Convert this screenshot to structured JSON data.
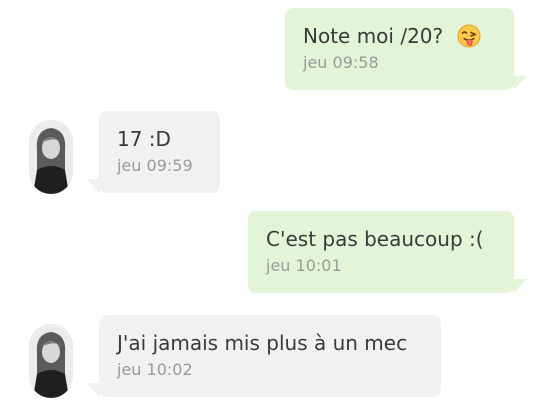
{
  "conversation": {
    "messages": [
      {
        "direction": "outgoing",
        "text": "Note moi /20?",
        "emoji": "winking-tongue-emoji",
        "time": "jeu 09:58"
      },
      {
        "direction": "incoming",
        "text": "17 :D",
        "time": "jeu 09:59"
      },
      {
        "direction": "outgoing",
        "text": "C'est pas beaucoup :(",
        "time": "jeu 10:01"
      },
      {
        "direction": "incoming",
        "text": "J'ai jamais mis plus à un mec",
        "time": "jeu 10:02"
      }
    ]
  },
  "colors": {
    "outgoing_bubble": "#e3f5d8",
    "incoming_bubble": "#f1f1f1",
    "message_text": "#3a3a3a",
    "timestamp_text": "#9a9a9a"
  }
}
